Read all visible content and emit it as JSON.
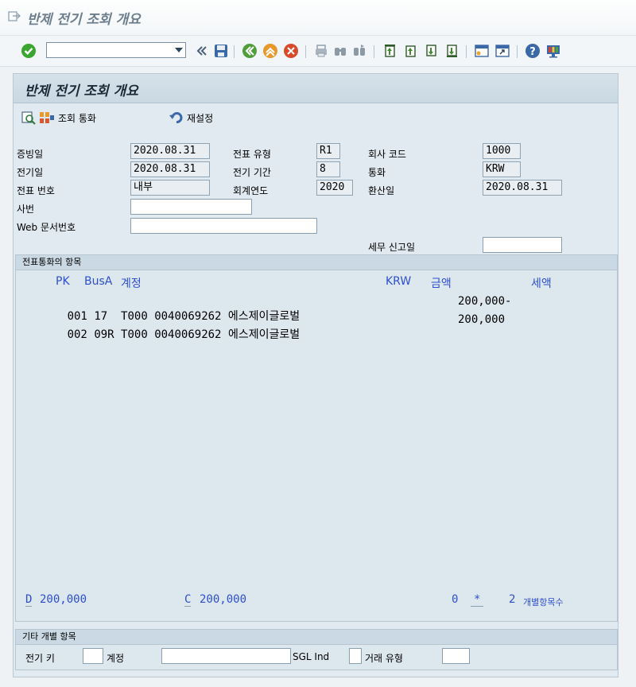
{
  "window": {
    "title": "반제 전기 조회 개요"
  },
  "toolbar": {
    "command_value": ""
  },
  "panel": {
    "title": "반제 전기 조회 개요"
  },
  "app_toolbar": {
    "currency_label": "조회 통화",
    "reset_label": "재설정"
  },
  "header": {
    "doc_date_label": "증빙일",
    "doc_date": "2020.08.31",
    "post_date_label": "전기일",
    "post_date": "2020.08.31",
    "doc_no_label": "전표 번호",
    "doc_no": "내부",
    "ref_label": "사번",
    "ref": "",
    "web_label": "Web 문서번호",
    "web": "",
    "doc_type_label": "전표 유형",
    "doc_type": "R1",
    "period_label": "전기 기간",
    "period": "8",
    "fiscal_year_label": "회계연도",
    "fiscal_year": "2020",
    "company_label": "회사 코드",
    "company": "1000",
    "currency_label": "통화",
    "currency": "KRW",
    "trans_date_label": "환산일",
    "trans_date": "2020.08.31",
    "tax_date_label": "세무 신고일",
    "tax_date": ""
  },
  "items": {
    "group_title": "전표통화의 항목",
    "columns": {
      "pk": "PK",
      "busa": "BusA",
      "account": "계정",
      "currency": "KRW",
      "amount": "금액",
      "tax": "세액"
    },
    "rows": [
      {
        "no": "001",
        "pk": "17",
        "busa": "T000",
        "account": "0040069262",
        "name": "에스제이글로벌",
        "amount": "200,000-"
      },
      {
        "no": "002",
        "pk": "09R",
        "busa": "T000",
        "account": "0040069262",
        "name": "에스제이글로벌",
        "amount": "200,000"
      }
    ],
    "debit_label": "D",
    "debit": "200,000",
    "credit_label": "C",
    "credit": "200,000",
    "balance": "0",
    "star": "*",
    "count": "2",
    "count_label": "개별항목수"
  },
  "other": {
    "group_title": "기타 개별 항목",
    "post_key_label": "전기 키",
    "post_key": "",
    "account_label": "계정",
    "account": "",
    "sgl_label": "SGL Ind",
    "sgl": "",
    "trans_type_label": "거래 유형",
    "trans_type": ""
  }
}
